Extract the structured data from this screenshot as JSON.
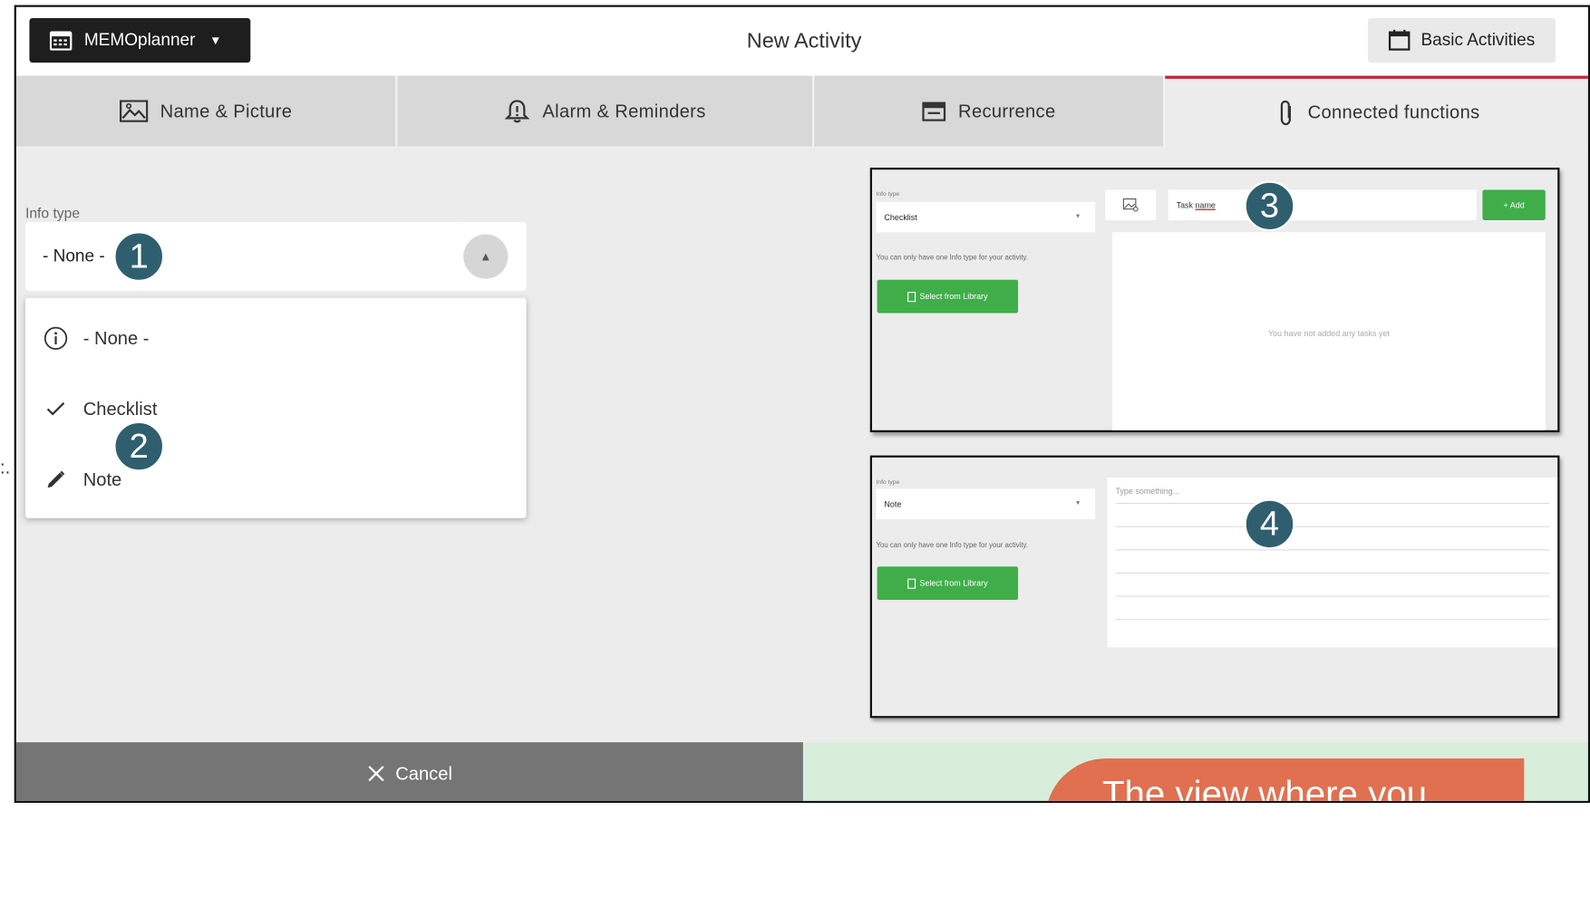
{
  "app": {
    "brand_label": "MEMOplanner",
    "title": "New Activity",
    "basic_activities_label": "Basic Activities"
  },
  "tabs": [
    {
      "label": "Name & Picture",
      "icon": "picture-icon"
    },
    {
      "label": "Alarm & Reminders",
      "icon": "alarm-bell-icon"
    },
    {
      "label": "Recurrence",
      "icon": "calendar-icon"
    },
    {
      "label": "Connected functions",
      "icon": "paperclip-icon",
      "active": true
    }
  ],
  "info_type": {
    "label": "Info type",
    "selected": "- None -",
    "options": [
      {
        "label": "- None -",
        "icon": "info-icon"
      },
      {
        "label": "Checklist",
        "icon": "check-icon"
      },
      {
        "label": "Note",
        "icon": "pencil-icon"
      }
    ]
  },
  "badges": [
    "1",
    "2",
    "3",
    "4"
  ],
  "checklist_preview": {
    "info_label": "Info type",
    "select_value": "Checklist",
    "note": "You can only have one Info type for your activity.",
    "library_button": "Select from Library",
    "task_placeholder_prefix": "Task ",
    "task_placeholder_underlined": "name",
    "add_button": "+ Add",
    "empty_text": "You have not added any tasks yet"
  },
  "note_preview": {
    "info_label": "Info type",
    "select_value": "Note",
    "note": "You can only have one Info type for your activity.",
    "library_button": "Select from Library",
    "placeholder": "Type something..."
  },
  "footer": {
    "cancel_label": "Cancel",
    "callout_text": "The view where you"
  },
  "edge_text": ":.",
  "colors": {
    "active_tab_accent": "#c4283a",
    "green_button": "#3fae49",
    "badge": "#2f5f6e",
    "callout": "#e07050",
    "cancel_bar": "#757575",
    "save_bar": "#d9eeda"
  }
}
